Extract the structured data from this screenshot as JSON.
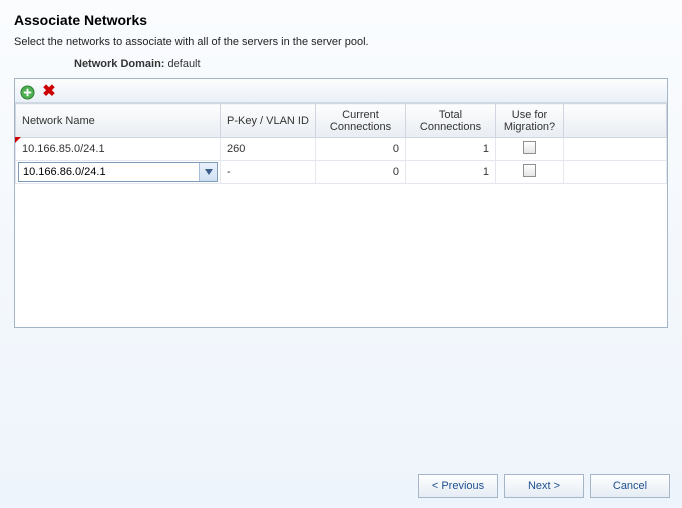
{
  "title": "Associate Networks",
  "description": "Select the networks to associate with all of the servers in the server pool.",
  "domain": {
    "label": "Network Domain:",
    "value": "default"
  },
  "columns": {
    "name": "Network Name",
    "pkey": "P-Key / VLAN ID",
    "current": "Current Connections",
    "total": "Total Connections",
    "migration": "Use for Migration?"
  },
  "rows": [
    {
      "name": "10.166.85.0/24.1",
      "pkey": "260",
      "current": "0",
      "total": "1"
    },
    {
      "name": "10.166.86.0/24.1",
      "pkey": "-",
      "current": "0",
      "total": "1"
    }
  ],
  "buttons": {
    "prev": "< Previous",
    "next": "Next >",
    "cancel": "Cancel"
  }
}
